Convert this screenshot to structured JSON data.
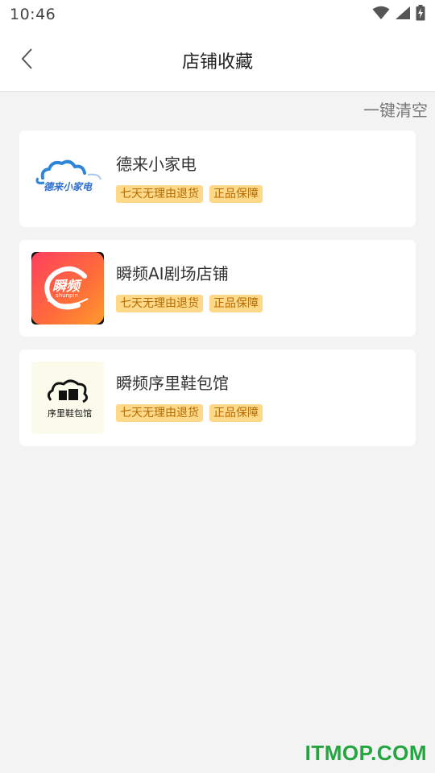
{
  "status_bar": {
    "time": "10:46",
    "icons": [
      "wifi-icon",
      "cellular-signal-icon",
      "battery-charging-icon"
    ]
  },
  "nav": {
    "title": "店铺收藏",
    "back_icon": "chevron-left-icon"
  },
  "clear_all_label": "一键清空",
  "shops": [
    {
      "name": "德来小家电",
      "logo_text": "德来小家电",
      "tags": [
        "七天无理由退货",
        "正品保障"
      ]
    },
    {
      "name": "瞬频AI剧场店铺",
      "logo_text": "瞬频",
      "logo_subtext": "shunpin",
      "tags": [
        "七天无理由退货",
        "正品保障"
      ]
    },
    {
      "name": "瞬频序里鞋包馆",
      "logo_text": "序里鞋包馆",
      "tags": [
        "七天无理由退货",
        "正品保障"
      ]
    }
  ],
  "colors": {
    "tag_bg": "#ffd98a",
    "tag_text": "#b56b00",
    "page_bg": "#f3f3f3",
    "watermark": "#23a540"
  },
  "watermark": "ITMOP.COM"
}
